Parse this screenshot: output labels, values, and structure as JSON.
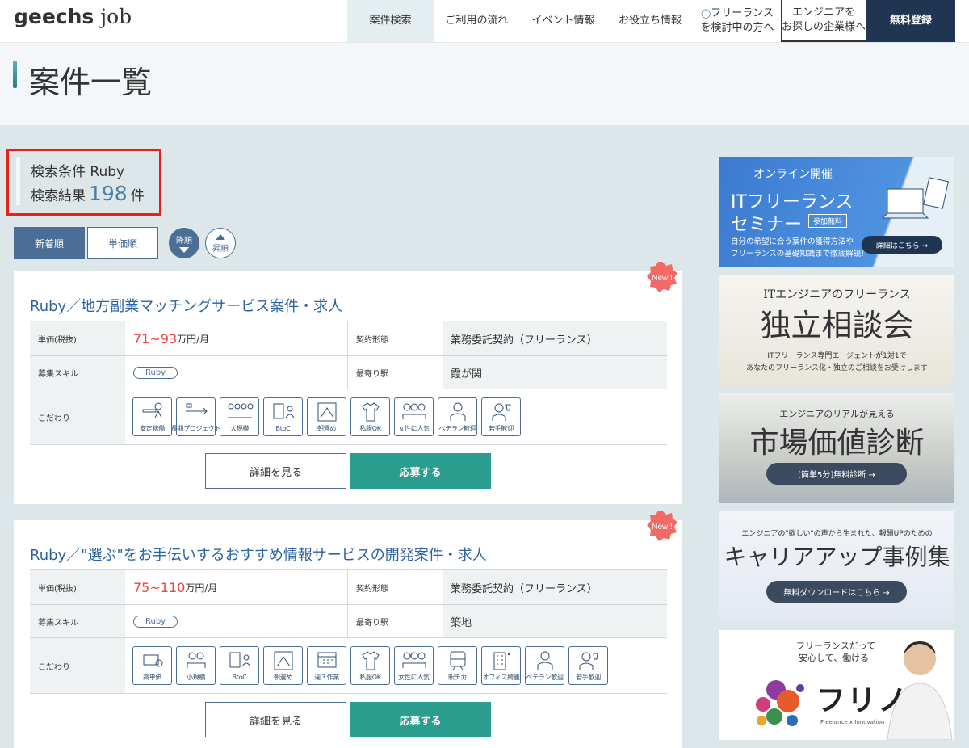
{
  "header": {
    "logo_main": "geechs",
    "logo_sub": "job",
    "nav": [
      "案件検索",
      "ご利用の流れ",
      "イベント情報",
      "お役立ち情報"
    ],
    "freelance_line1": "フリーランス",
    "freelance_line2": "を検討中の方へ",
    "company_line1": "エンジニアを",
    "company_line2": "お探しの企業様へ",
    "register": "無料登録"
  },
  "page_title": "案件一覧",
  "search": {
    "cond_label": "検索条件",
    "cond_value": "Ruby",
    "result_label": "検索結果",
    "result_count": "198",
    "result_unit": "件"
  },
  "sort": {
    "newest": "新着順",
    "price": "単価順",
    "desc": "降順",
    "asc": "昇順"
  },
  "labels": {
    "price": "単価(税抜)",
    "contract": "契約形態",
    "skill": "募集スキル",
    "station": "最寄り駅",
    "features": "こだわり",
    "new_badge": "New!!",
    "detail": "詳細を見る",
    "apply": "応募する"
  },
  "jobs": [
    {
      "title": "Ruby／地方副業マッチングサービス案件・求人",
      "price": "71~93",
      "price_unit": "万円/月",
      "contract": "業務委託契約（フリーランス）",
      "skill": "Ruby",
      "station": "霞が関",
      "features": [
        "安定稼働",
        "長期プロジェクト",
        "大規模",
        "BtoC",
        "朝遅め",
        "私服OK",
        "女性に人気",
        "ベテラン歓迎",
        "若手歓迎"
      ]
    },
    {
      "title": "Ruby／\"選ぶ\"をお手伝いするおすすめ情報サービスの開発案件・求人",
      "price": "75~110",
      "price_unit": "万円/月",
      "contract": "業務委託契約（フリーランス）",
      "skill": "Ruby",
      "station": "築地",
      "features": [
        "高単価",
        "小規模",
        "BtoC",
        "朝遅め",
        "週３作業",
        "私服OK",
        "女性に人気",
        "駅チカ",
        "オフィス綺麗",
        "ベテラン歓迎",
        "若手歓迎"
      ]
    }
  ],
  "banners": {
    "b1_top": "オンライン開催",
    "b1_title1": "ITフリーランス",
    "b1_title2": "セミナー",
    "b1_tag": "参加無料",
    "b1_desc1": "自分の希望に合う案件の獲得方法や",
    "b1_desc2": "フリーランスの基礎知識まで徹底解説!",
    "b1_btn": "詳細はこちら →",
    "b2_top": "ITエンジニアのフリーランス",
    "b2_title": "独立相談会",
    "b2_desc1": "ITフリーランス専門エージェントが1対1で",
    "b2_desc2": "あなたのフリーランス化・独立のご相談をお受けします",
    "b3_top": "エンジニアのリアルが見える",
    "b3_title": "市場価値診断",
    "b3_btn": "[簡単5分]無料診断 →",
    "b4_top": "エンジニアの\"欲しい\"の声から生まれた、報酬UPのための",
    "b4_title": "キャリアアップ事例集",
    "b4_btn": "無料ダウンロードはこちら →",
    "b5_line1": "フリーランスだって",
    "b5_line2": "安心して、働ける",
    "b5_logo": "フリノベ",
    "b5_sub": "Freelance x Innovation"
  },
  "colors": {
    "accent": "#2a9d8f",
    "navy": "#1f3551",
    "link": "#2b62a3",
    "price": "#e8483f",
    "highlight": "#e8201a"
  }
}
